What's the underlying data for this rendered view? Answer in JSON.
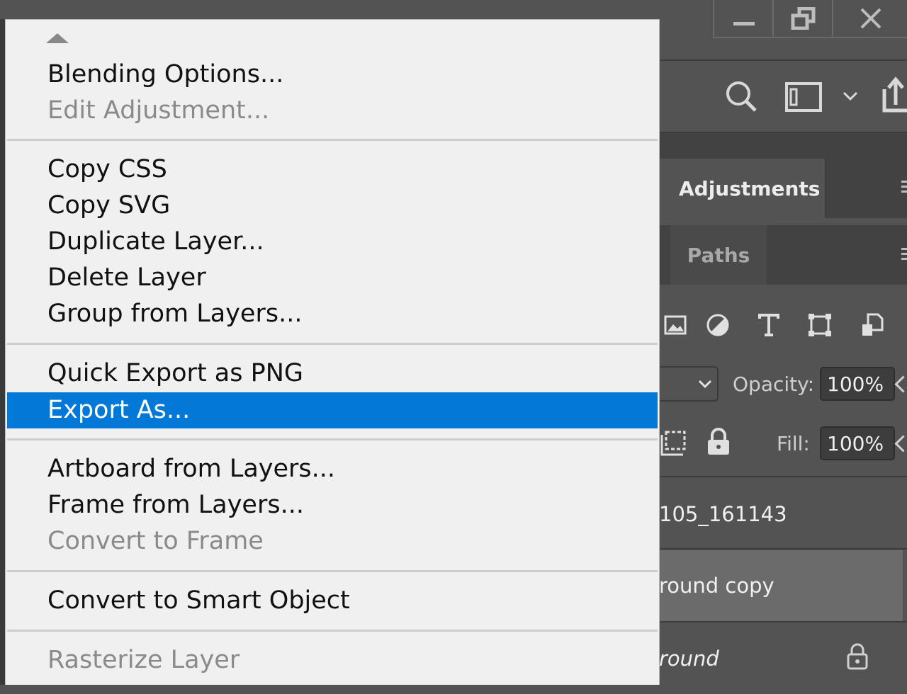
{
  "context_menu": {
    "items": [
      {
        "label": "Blending Options...",
        "enabled": true
      },
      {
        "label": "Edit Adjustment...",
        "enabled": false
      },
      {
        "label": "Copy CSS",
        "enabled": true
      },
      {
        "label": "Copy SVG",
        "enabled": true
      },
      {
        "label": "Duplicate Layer...",
        "enabled": true
      },
      {
        "label": "Delete Layer",
        "enabled": true
      },
      {
        "label": "Group from Layers...",
        "enabled": true
      },
      {
        "label": "Quick Export as PNG",
        "enabled": true
      },
      {
        "label": "Export As...",
        "enabled": true,
        "highlighted": true
      },
      {
        "label": "Artboard from Layers...",
        "enabled": true
      },
      {
        "label": "Frame from Layers...",
        "enabled": true
      },
      {
        "label": "Convert to Frame",
        "enabled": false
      },
      {
        "label": "Convert to Smart Object",
        "enabled": true
      },
      {
        "label": "Rasterize Layer",
        "enabled": false
      }
    ],
    "highlight_color": "#0378d7"
  },
  "panels": {
    "adjustments_tab": "Adjustments",
    "paths_tab": "Paths",
    "opacity_label": "Opacity:",
    "opacity_value": "100%",
    "fill_label": "Fill:",
    "fill_value": "100%"
  },
  "layers": [
    {
      "name": "105_161143",
      "selected": false
    },
    {
      "name": "round copy",
      "selected": true
    },
    {
      "name": "round",
      "selected": false,
      "italic": true,
      "locked": true
    }
  ],
  "icons": [
    "minimize-icon",
    "restore-icon",
    "close-icon",
    "search-icon",
    "workspace-icon",
    "chevron-down-icon",
    "share-icon",
    "image-filter-icon",
    "adjustment-filter-icon",
    "type-filter-icon",
    "shape-filter-icon",
    "smart-object-filter-icon",
    "lock-artboard-icon",
    "lock-icon"
  ]
}
